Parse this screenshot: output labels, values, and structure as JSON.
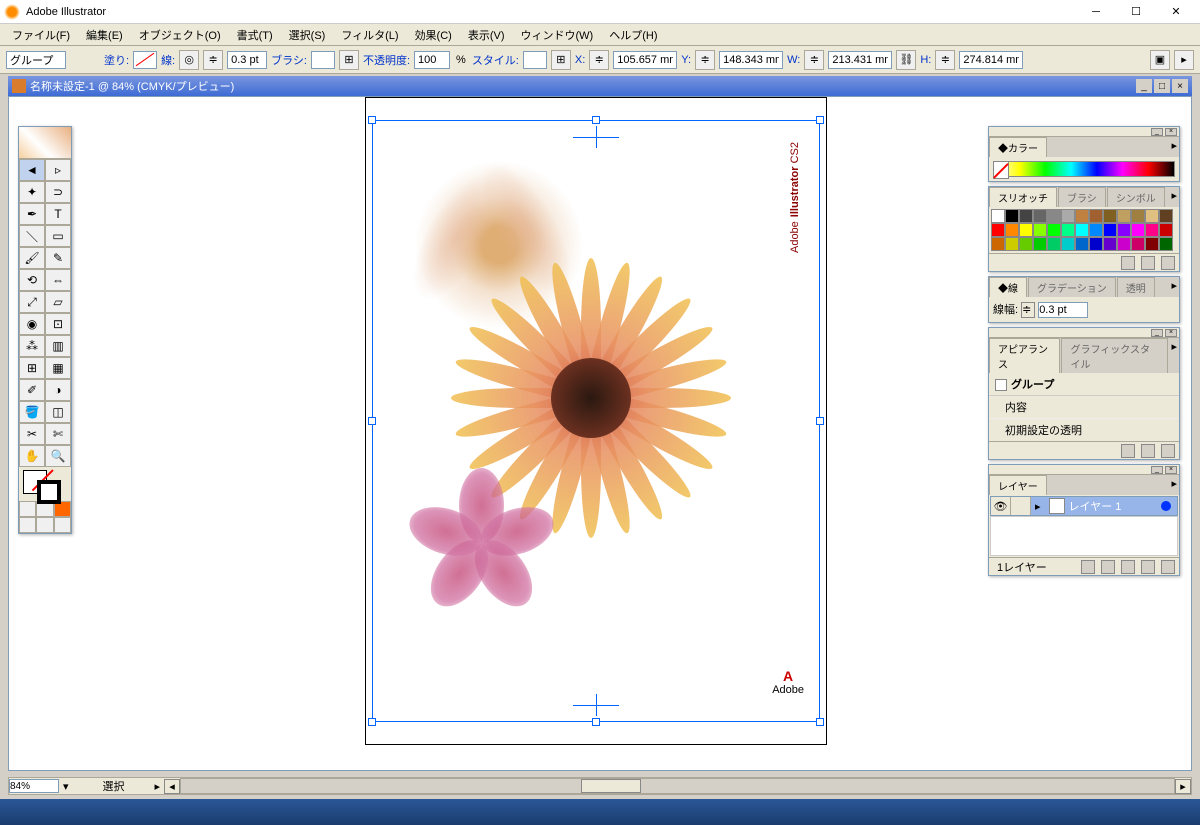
{
  "app": {
    "title": "Adobe Illustrator"
  },
  "menu": {
    "items": [
      "ファイル(F)",
      "編集(E)",
      "オブジェクト(O)",
      "書式(T)",
      "選択(S)",
      "フィルタ(L)",
      "効果(C)",
      "表示(V)",
      "ウィンドウ(W)",
      "ヘルプ(H)"
    ]
  },
  "opt": {
    "selection_type": "グループ",
    "fill_label": "塗り:",
    "stroke_label": "線:",
    "stroke_weight": "0.3 pt",
    "brush_label": "ブラシ:",
    "opacity_label": "不透明度:",
    "opacity_value": "100",
    "opacity_pct": "%",
    "style_label": "スタイル:",
    "x_label": "X:",
    "x_value": "105.657 mm",
    "y_label": "Y:",
    "y_value": "148.343 mm",
    "w_label": "W:",
    "w_value": "213.431 mm",
    "h_label": "H:",
    "h_value": "274.814 mm"
  },
  "doc": {
    "title": "名称未設定-1 @ 84% (CMYK/プレビュー)"
  },
  "artboard": {
    "vtext_adobe": "Adobe",
    "vtext_ill": "Illustrator",
    "vtext_cs2": " CS2",
    "logo_a": "A",
    "logo_label": "Adobe"
  },
  "panels": {
    "color": {
      "tab": "◆カラー"
    },
    "swatches": {
      "tabs": [
        "スリオッチ",
        "ブラシ",
        "シンボル"
      ]
    },
    "stroke": {
      "tabs": [
        "◆線",
        "グラデーション",
        "透明"
      ],
      "label": "線幅:",
      "value": "0.3 pt"
    },
    "appearance": {
      "tabs": [
        "アピアランス",
        "グラフィックスタイル"
      ],
      "group": "グループ",
      "content": "内容",
      "default_transp": "初期設定の透明"
    },
    "layers": {
      "tab": "レイヤー",
      "layer1": "レイヤー 1",
      "count": "1レイヤー"
    }
  },
  "status": {
    "zoom": "84%",
    "mode": "選択"
  },
  "swatch_colors": [
    "#ffffff",
    "#000000",
    "#444444",
    "#666666",
    "#888888",
    "#aaaaaa",
    "#c08040",
    "#a06030",
    "#806020",
    "#c0a060",
    "#a08040",
    "#e0c080",
    "#604020",
    "#ff0000",
    "#ff8800",
    "#ffff00",
    "#88ff00",
    "#00ff00",
    "#00ff88",
    "#00ffff",
    "#0088ff",
    "#0000ff",
    "#8800ff",
    "#ff00ff",
    "#ff0088",
    "#cc0000",
    "#cc6600",
    "#cccc00",
    "#66cc00",
    "#00cc00",
    "#00cc66",
    "#00cccc",
    "#0066cc",
    "#0000cc",
    "#6600cc",
    "#cc00cc",
    "#cc0066",
    "#800000",
    "#006600"
  ]
}
